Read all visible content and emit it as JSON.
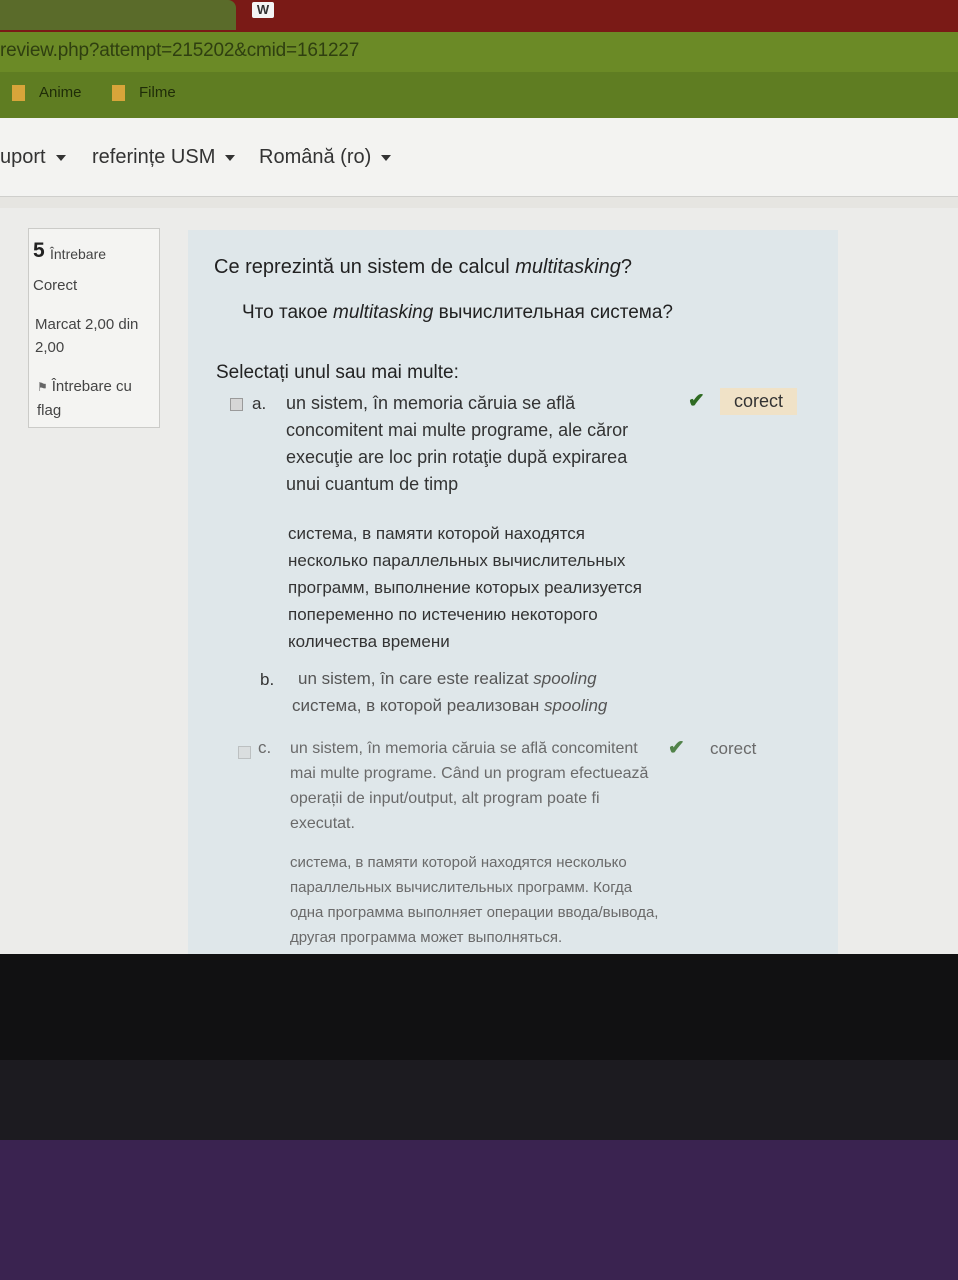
{
  "browser": {
    "url": "review.php?attempt=215202&cmid=161227",
    "tab_icon": "W",
    "bookmarks": [
      "Anime",
      "Filme"
    ]
  },
  "navbar": {
    "items": [
      "uport",
      "referințe USM",
      "Română (ro)"
    ]
  },
  "question_info": {
    "number": "5",
    "label": "Întrebare",
    "state": "Corect",
    "grade": "Marcat 2,00 din 2,00",
    "flag": "Întrebare cu flag"
  },
  "question": {
    "text_ro": "Ce reprezintă un sistem de calcul ",
    "text_ro_em": "multitasking",
    "text_ro_end": "?",
    "text_ru": "Что такое ",
    "text_ru_em": "multitasking",
    "text_ru_end": "  вычислительная система?",
    "prompt": "Selectați unul sau mai multe:",
    "options": [
      {
        "letter": "a.",
        "ro": "un sistem, în memoria căruia se află concomitent mai multe programe, ale căror execuţie are loc prin rotaţie după expirarea unui cuantum de timp",
        "ru": "система, в памяти которой находятся несколько параллельных вычислительных программ, выполнение которых реализуется попеременно по истечению некоторого количества времени",
        "feedback": "corect"
      },
      {
        "letter": "b.",
        "ro": "un sistem, în care este realizat ",
        "ro_em": "spooling",
        "ru": "система, в которой реализован ",
        "ru_em": "spooling"
      },
      {
        "letter": "c.",
        "ro": "un sistem, în memoria căruia se află concomitent mai multe programe. Când un program efectuează operații de input/output, alt program poate fi executat.",
        "ru": "система, в памяти которой находятся несколько параллельных вычислительных программ. Когда одна программа выполняет операции ввода/вывода, другая программа может выполняться.",
        "feedback": "corect"
      }
    ]
  }
}
